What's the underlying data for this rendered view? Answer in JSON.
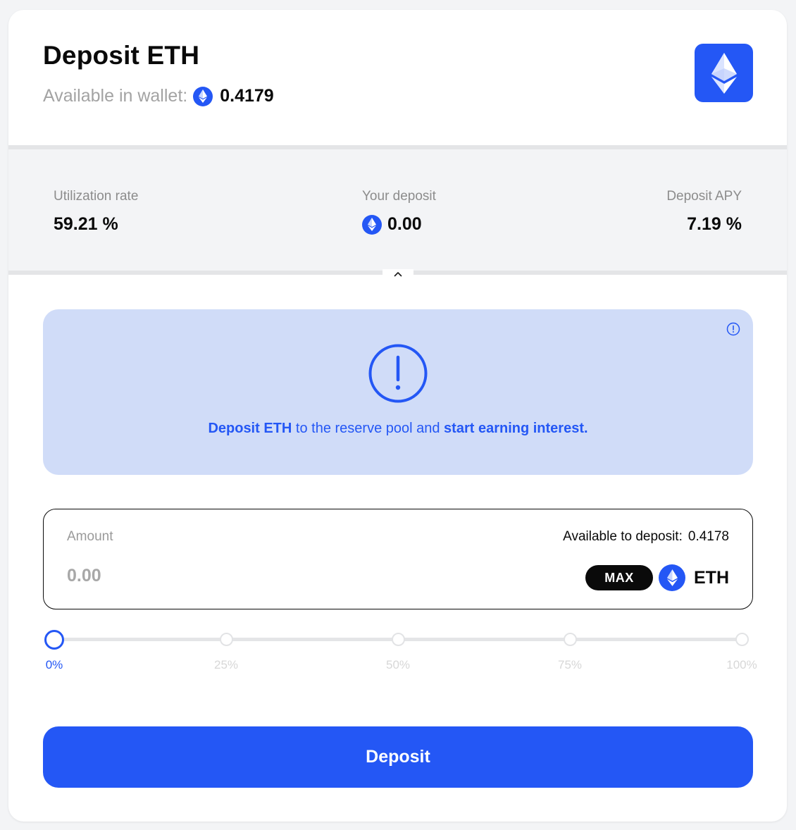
{
  "header": {
    "title": "Deposit ETH",
    "wallet_label": "Available in wallet:",
    "wallet_value": "0.4179"
  },
  "stats": {
    "utilization_label": "Utilization rate",
    "utilization_value": "59.21 %",
    "deposit_label": "Your deposit",
    "deposit_value": "0.00",
    "apy_label": "Deposit APY",
    "apy_value": "7.19 %"
  },
  "info": {
    "text_bold_1": "Deposit ETH",
    "text_mid": " to the reserve pool and ",
    "text_bold_2": "start earning interest."
  },
  "amount": {
    "label": "Amount",
    "available_label": "Available to deposit:",
    "available_value": "0.4178",
    "placeholder": "0.00",
    "max_label": "MAX",
    "token": "ETH"
  },
  "slider": {
    "value_fraction": 0,
    "labels": [
      "0%",
      "25%",
      "50%",
      "75%",
      "100%"
    ]
  },
  "actions": {
    "deposit_label": "Deposit"
  },
  "icons": {
    "token": "eth-icon",
    "info_small": "info-circle-icon",
    "info_big": "exclamation-circle-icon",
    "collapse": "chevron-up-icon"
  },
  "colors": {
    "accent": "#2457f5",
    "info_bg": "#d0dcf8",
    "stats_bg": "#f3f4f6"
  }
}
